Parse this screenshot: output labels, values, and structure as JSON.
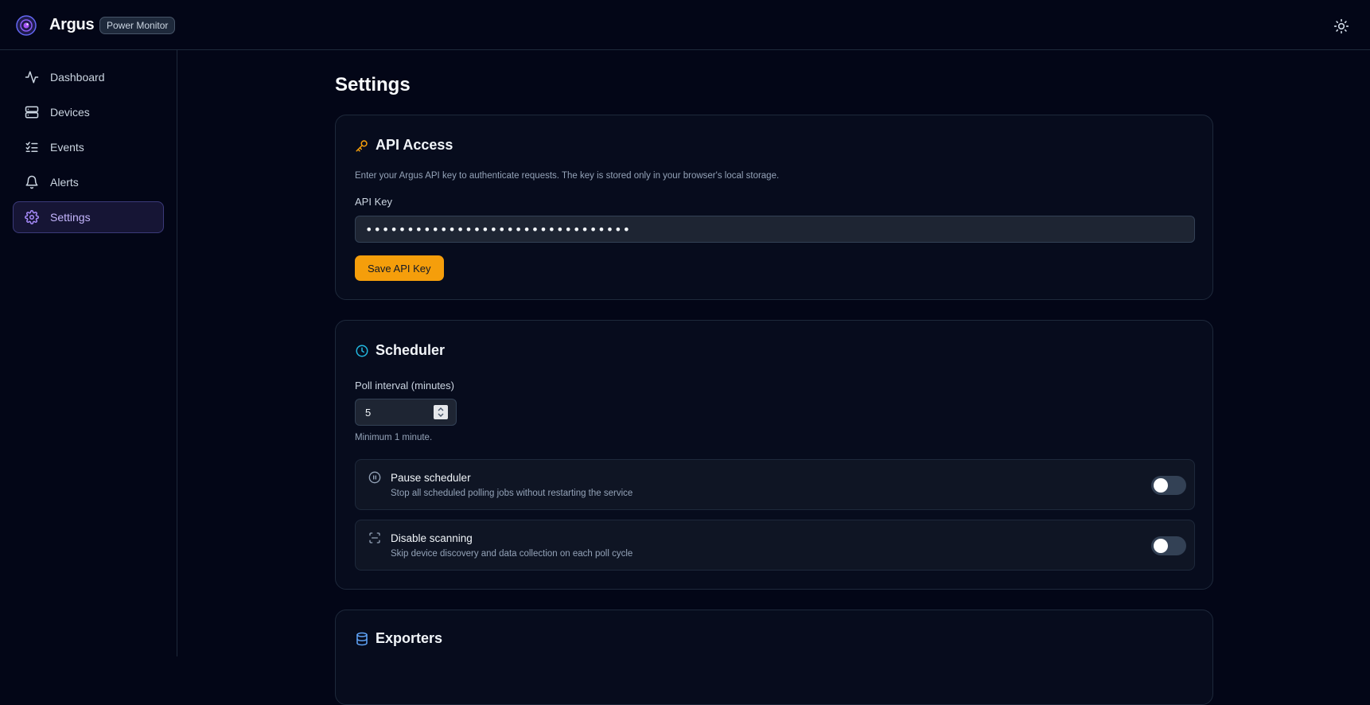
{
  "app": {
    "name": "Argus",
    "badge": "Power Monitor"
  },
  "colors": {
    "accent": "#f59e0b",
    "active_nav": "#c4b5fd",
    "scheduler_icon": "#22b8e0"
  },
  "sidebar": {
    "items": [
      {
        "label": "Dashboard",
        "icon": "activity-icon"
      },
      {
        "label": "Devices",
        "icon": "server-icon"
      },
      {
        "label": "Events",
        "icon": "list-checks-icon"
      },
      {
        "label": "Alerts",
        "icon": "bell-icon"
      },
      {
        "label": "Settings",
        "icon": "gear-icon",
        "active": true
      }
    ]
  },
  "page": {
    "title": "Settings"
  },
  "api_access": {
    "title": "API Access",
    "description": "Enter your Argus API key to authenticate requests. The key is stored only in your browser's local storage.",
    "key_label": "API Key",
    "key_value": "••••••••••••••••••••••••••••••••",
    "save_label": "Save API Key"
  },
  "scheduler": {
    "title": "Scheduler",
    "poll_label": "Poll interval (minutes)",
    "poll_value": "5",
    "poll_hint": "Minimum 1 minute.",
    "pause": {
      "title": "Pause scheduler",
      "subtitle": "Stop all scheduled polling jobs without restarting the service",
      "enabled": false
    },
    "disable_scanning": {
      "title": "Disable scanning",
      "subtitle": "Skip device discovery and data collection on each poll cycle",
      "enabled": false
    }
  },
  "exporters": {
    "title": "Exporters"
  }
}
